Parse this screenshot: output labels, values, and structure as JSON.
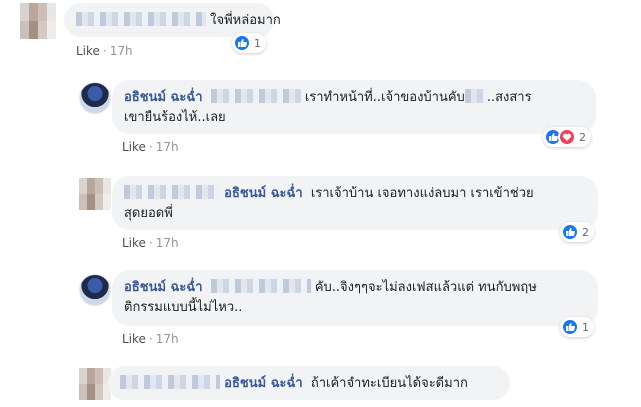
{
  "colors": {
    "name": "#385898",
    "bubble": "#f2f3f5",
    "like_icon": "#1877f2",
    "love_icon": "#f33e58",
    "meta": "#90949c"
  },
  "comments": [
    {
      "text": "ใจพี่หล่อมาก",
      "like_label": "Like",
      "sep": "·",
      "time": "17h",
      "reaction_count": "1"
    },
    {
      "name": "อธิชนม์ ฉะฉ่ำ",
      "line1": "เราทำหน้าที่..เจ้าของบ้านคับ",
      "line1b": "..สงสาร",
      "line2": "เขายืนร้องไห้..เลย",
      "like_label": "Like",
      "sep": "·",
      "time": "17h",
      "reaction_count": "2"
    },
    {
      "name": "อธิชนม์ ฉะฉ่ำ",
      "line1": "เราเจ้าบ้าน เจอทางแง่ลบมา เราเข้าช่วย",
      "line2": "สุดยอดพี่",
      "like_label": "Like",
      "sep": "·",
      "time": "17h",
      "reaction_count": "2"
    },
    {
      "name": "อธิชนม์ ฉะฉ่ำ",
      "line1": "คับ..จิงๆๆจะไม่ลงเฟสแล้วแต่ ทนกับพฤษ",
      "line2": "ติกรรมแบบนี้ไม่ไหว..",
      "like_label": "Like",
      "sep": "·",
      "time": "17h",
      "reaction_count": "1"
    },
    {
      "name": "อธิชนม์ ฉะฉ่ำ",
      "line1": "ถ้าเค้าจำทะเบียนได้จะดีมาก"
    }
  ]
}
